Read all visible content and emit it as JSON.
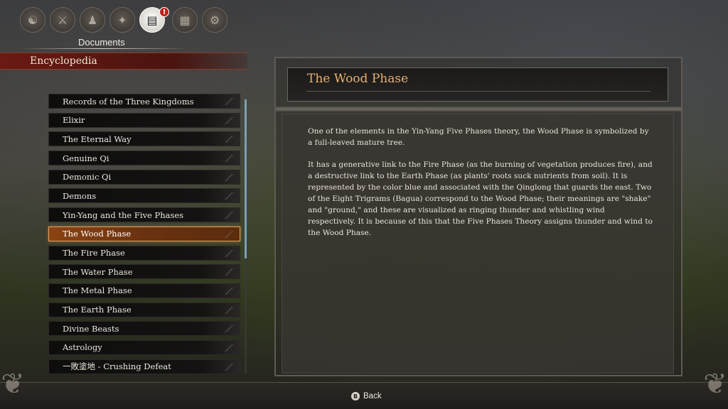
{
  "topbar": {
    "title": "Documents",
    "badge": "!",
    "icons": [
      {
        "name": "character",
        "glyph": "☯"
      },
      {
        "name": "items",
        "glyph": "⚔"
      },
      {
        "name": "meditation",
        "glyph": "♟"
      },
      {
        "name": "skills",
        "glyph": "✦"
      },
      {
        "name": "documents",
        "glyph": "▤"
      },
      {
        "name": "map",
        "glyph": "▦"
      },
      {
        "name": "settings",
        "glyph": "⚙"
      }
    ]
  },
  "encyclopedia": {
    "title": "Encyclopedia",
    "items": [
      "Records of the Three Kingdoms",
      "Elixir",
      "The Eternal Way",
      "Genuine Qi",
      "Demonic Qi",
      "Demons",
      "Yin-Yang and the Five Phases",
      "The Wood Phase",
      "The Fire Phase",
      "The Water Phase",
      "The Metal Phase",
      "The Earth Phase",
      "Divine Beasts",
      "Astrology",
      "一敗塗地 - Crushing Defeat"
    ],
    "selected_index": 7
  },
  "entry": {
    "title": "The Wood Phase",
    "paragraph1": "One of the elements in the Yin-Yang Five Phases theory, the Wood Phase is symbolized by a full-leaved mature tree.",
    "paragraph2": "It has a generative link to the Fire Phase (as the burning of vegetation produces fire), and a destructive link to the Earth Phase (as plants' roots suck nutrients from soil). It is represented by the color blue and associated with the Qinglong that guards the east. Two of the Eight Trigrams (Bagua) correspond to the Wood Phase; their meanings are \"shake\" and \"ground,\" and these are visualized as ringing thunder and whistling wind respectively. It is because of this that the Five Phases Theory assigns thunder and wind to the Wood Phase."
  },
  "footer": {
    "back_button_glyph": "B",
    "back_label": "Back"
  },
  "colors": {
    "accent_title": "#e6b173",
    "selected_item": "#8a4413",
    "header_red": "#6b1a12",
    "scrollbar": "#7a9fb3"
  }
}
